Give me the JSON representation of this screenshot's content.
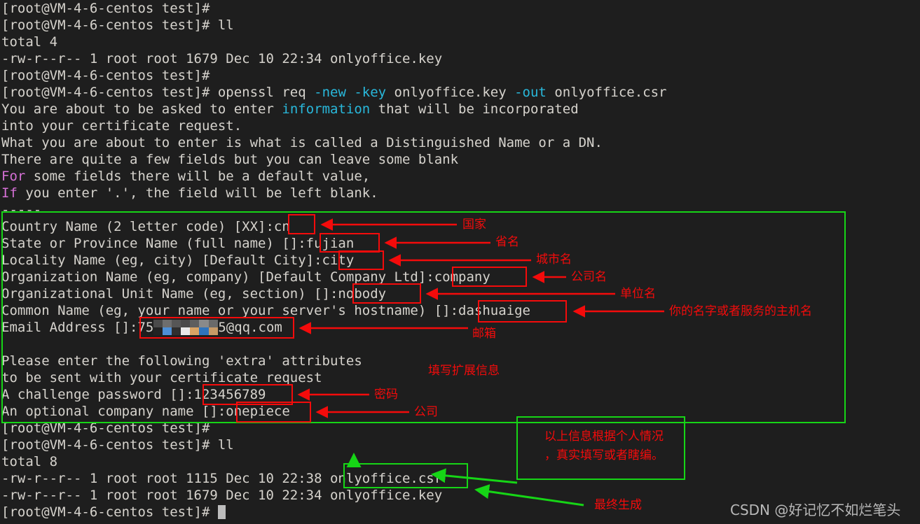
{
  "terminal": {
    "prompt": "[root@VM-4-6-centos test]#",
    "colors": {
      "background": "#1e1e1e",
      "foreground": "#d6d3cd",
      "cyan": "#29b8db",
      "magenta": "#d670d6",
      "red_annotation": "#f40b0b",
      "green_annotation": "#16d516",
      "watermark": "#b9b9b9"
    },
    "lines": [
      {
        "id": "l1",
        "text": "[root@VM-4-6-centos test]#"
      },
      {
        "id": "l2",
        "text": "[root@VM-4-6-centos test]# ll"
      },
      {
        "id": "l3",
        "text": "total 4"
      },
      {
        "id": "l4",
        "text": "-rw-r--r-- 1 root root 1679 Dec 10 22:34 onlyoffice.key"
      },
      {
        "id": "l5",
        "text": "[root@VM-4-6-centos test]#"
      },
      {
        "id": "l6a",
        "text": "[root@VM-4-6-centos test]# openssl req "
      },
      {
        "id": "l6b",
        "text": "-new -key"
      },
      {
        "id": "l6c",
        "text": " onlyoffice.key "
      },
      {
        "id": "l6d",
        "text": "-out"
      },
      {
        "id": "l6e",
        "text": " onlyoffice.csr"
      },
      {
        "id": "l7a",
        "text": "You are about to be asked to enter "
      },
      {
        "id": "l7b",
        "text": "information"
      },
      {
        "id": "l7c",
        "text": " that will be incorporated"
      },
      {
        "id": "l8",
        "text": "into your certificate request."
      },
      {
        "id": "l9",
        "text": "What you are about to enter is what is called a Distinguished Name or a DN."
      },
      {
        "id": "l10",
        "text": "There are quite a few fields but you can leave some blank"
      },
      {
        "id": "l11a",
        "text": "For"
      },
      {
        "id": "l11b",
        "text": " some fields there will be a default value,"
      },
      {
        "id": "l12a",
        "text": "If"
      },
      {
        "id": "l12b",
        "text": " you enter '.', the field will be left blank."
      },
      {
        "id": "l13",
        "text": "-----"
      },
      {
        "id": "l14",
        "text": "Country Name (2 letter code) [XX]:cn"
      },
      {
        "id": "l15",
        "text": "State or Province Name (full name) []:fujian"
      },
      {
        "id": "l16",
        "text": "Locality Name (eg, city) [Default City]:city"
      },
      {
        "id": "l17",
        "text": "Organization Name (eg, company) [Default Company Ltd]:company"
      },
      {
        "id": "l18",
        "text": "Organizational Unit Name (eg, section) []:nobody"
      },
      {
        "id": "l19",
        "text": "Common Name (eg, your name or your server's hostname) []:dashuaige"
      },
      {
        "id": "l20a",
        "text": "Email Address []:75"
      },
      {
        "id": "l20b",
        "text": "5@qq.com"
      },
      {
        "id": "l21",
        "text": ""
      },
      {
        "id": "l22",
        "text": "Please enter the following 'extra' attributes"
      },
      {
        "id": "l23",
        "text": "to be sent with your certificate request"
      },
      {
        "id": "l24",
        "text": "A challenge password []:123456789"
      },
      {
        "id": "l25",
        "text": "An optional company name []:onepiece"
      },
      {
        "id": "l26",
        "text": "[root@VM-4-6-centos test]#"
      },
      {
        "id": "l27",
        "text": "[root@VM-4-6-centos test]# ll"
      },
      {
        "id": "l28",
        "text": "total 8"
      },
      {
        "id": "l29",
        "text": "-rw-r--r-- 1 root root 1115 Dec 10 22:38 onlyoffice.csr"
      },
      {
        "id": "l30",
        "text": "-rw-r--r-- 1 root root 1679 Dec 10 22:34 onlyoffice.key"
      },
      {
        "id": "l31",
        "text": "[root@VM-4-6-centos test]# "
      }
    ]
  },
  "annotations": {
    "country": "国家",
    "province": "省名",
    "city": "城市名",
    "company_name": "公司名",
    "unit_name": "单位名",
    "common_name": "你的名字或者服务的主机名",
    "email": "邮箱",
    "extra_info": "填写扩展信息",
    "password": "密码",
    "company": "公司",
    "note_line1": "以上信息根据个人情况",
    "note_line2": "，真实填写或者瞎编。",
    "final_output": "最终生成"
  },
  "watermark": {
    "text": "CSDN @好记忆不如烂笔头"
  }
}
